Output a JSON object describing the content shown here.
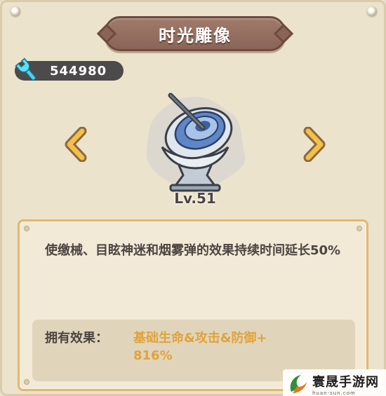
{
  "title": "时光雕像",
  "currency": {
    "icon": "wrench-icon",
    "value": "544980"
  },
  "item": {
    "icon": "sundial-statue-icon",
    "level": "Lv.51"
  },
  "description": "使缴械、目眩神迷和烟雾弹的效果持续时间延长50%",
  "effect": {
    "label": "拥有效果：",
    "value_line1": "基础生命&攻击&防御+",
    "value_line2": "816%"
  },
  "watermark": {
    "main": "寰晟手游网",
    "sub": "huan-sun.com"
  },
  "colors": {
    "accent_gold": "#e0a33c",
    "banner": "#8a6557",
    "panel_border": "#e2b772"
  }
}
